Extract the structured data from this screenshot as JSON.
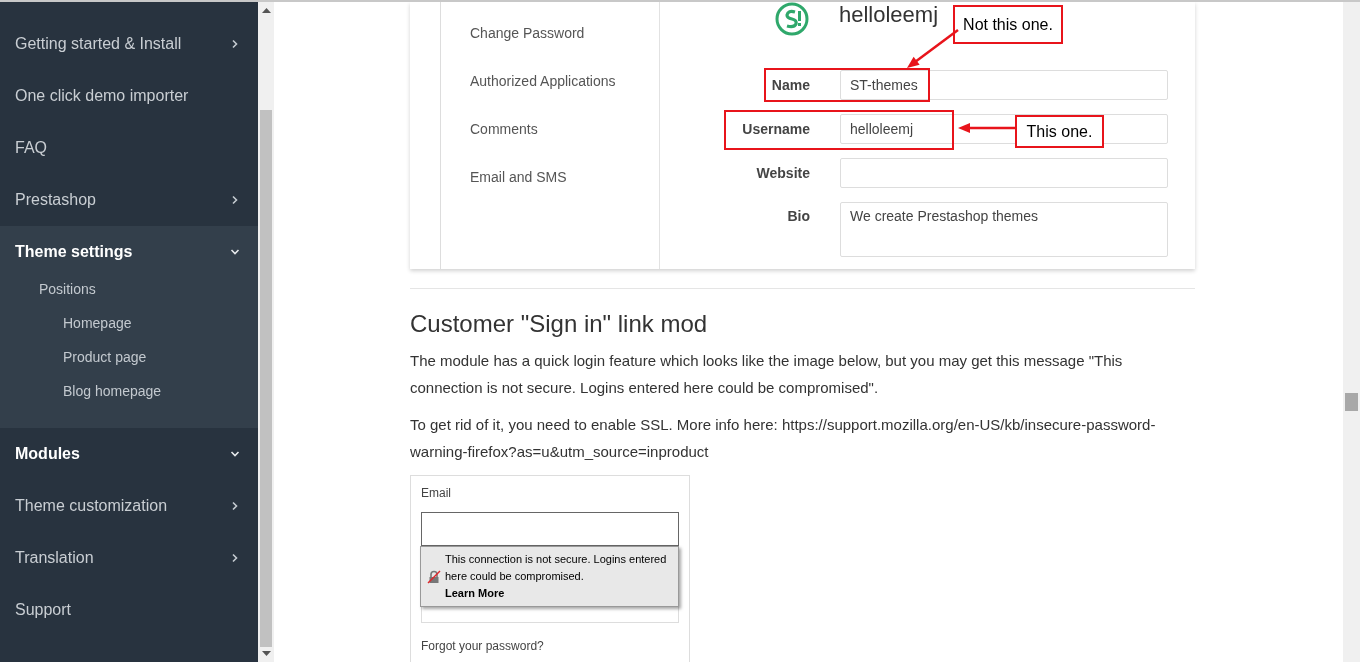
{
  "sidebar": {
    "items": [
      {
        "label": "Getting started & Install",
        "kind": "group",
        "expanded": false
      },
      {
        "label": "One click demo importer",
        "kind": "link"
      },
      {
        "label": "FAQ",
        "kind": "link"
      },
      {
        "label": "Prestashop",
        "kind": "group",
        "expanded": false
      },
      {
        "label": "Theme settings",
        "kind": "group",
        "expanded": true,
        "children": [
          {
            "label": "Positions",
            "children": [
              {
                "label": "Homepage"
              },
              {
                "label": "Product page"
              },
              {
                "label": "Blog homepage"
              }
            ]
          }
        ]
      },
      {
        "label": "Modules",
        "kind": "group",
        "expanded": true
      },
      {
        "label": "Theme customization",
        "kind": "group",
        "expanded": false
      },
      {
        "label": "Translation",
        "kind": "group",
        "expanded": false
      },
      {
        "label": "Support",
        "kind": "link"
      }
    ]
  },
  "content": {
    "profile_screenshot": {
      "menu": [
        "Change Password",
        "Authorized Applications",
        "Comments",
        "Email and SMS"
      ],
      "username_heading": "helloleemj",
      "fields": [
        {
          "label": "Name",
          "kind": "input",
          "value": "ST-themes",
          "highlighted": true
        },
        {
          "label": "Username",
          "kind": "input",
          "value": "helloleemj",
          "highlighted": true
        },
        {
          "label": "Website",
          "kind": "input",
          "highlighted": false
        },
        {
          "label": "Bio",
          "kind": "textarea",
          "value": "We create Prestashop themes",
          "highlighted": false
        }
      ],
      "annotations": [
        {
          "text": "Not this one."
        },
        {
          "text": "This one."
        }
      ]
    },
    "heading": "Customer \"Sign in\" link mod",
    "paragraphs": [
      "The module has a quick login feature which looks like the image below, but you may get this message \"This connection is not secure. Logins entered here could be compromised\".",
      "To get rid of it, you need to enable SSL. More info here: https://support.mozilla.org/en-US/kb/insecure-password-warning-firefox?as=u&utm_source=inproduct"
    ],
    "login_screenshot": {
      "email_label": "Email",
      "warning": {
        "text": "This connection is not secure. Logins entered here could be compromised.",
        "link": "Learn More"
      },
      "forgot_link": "Forgot your password?"
    }
  }
}
